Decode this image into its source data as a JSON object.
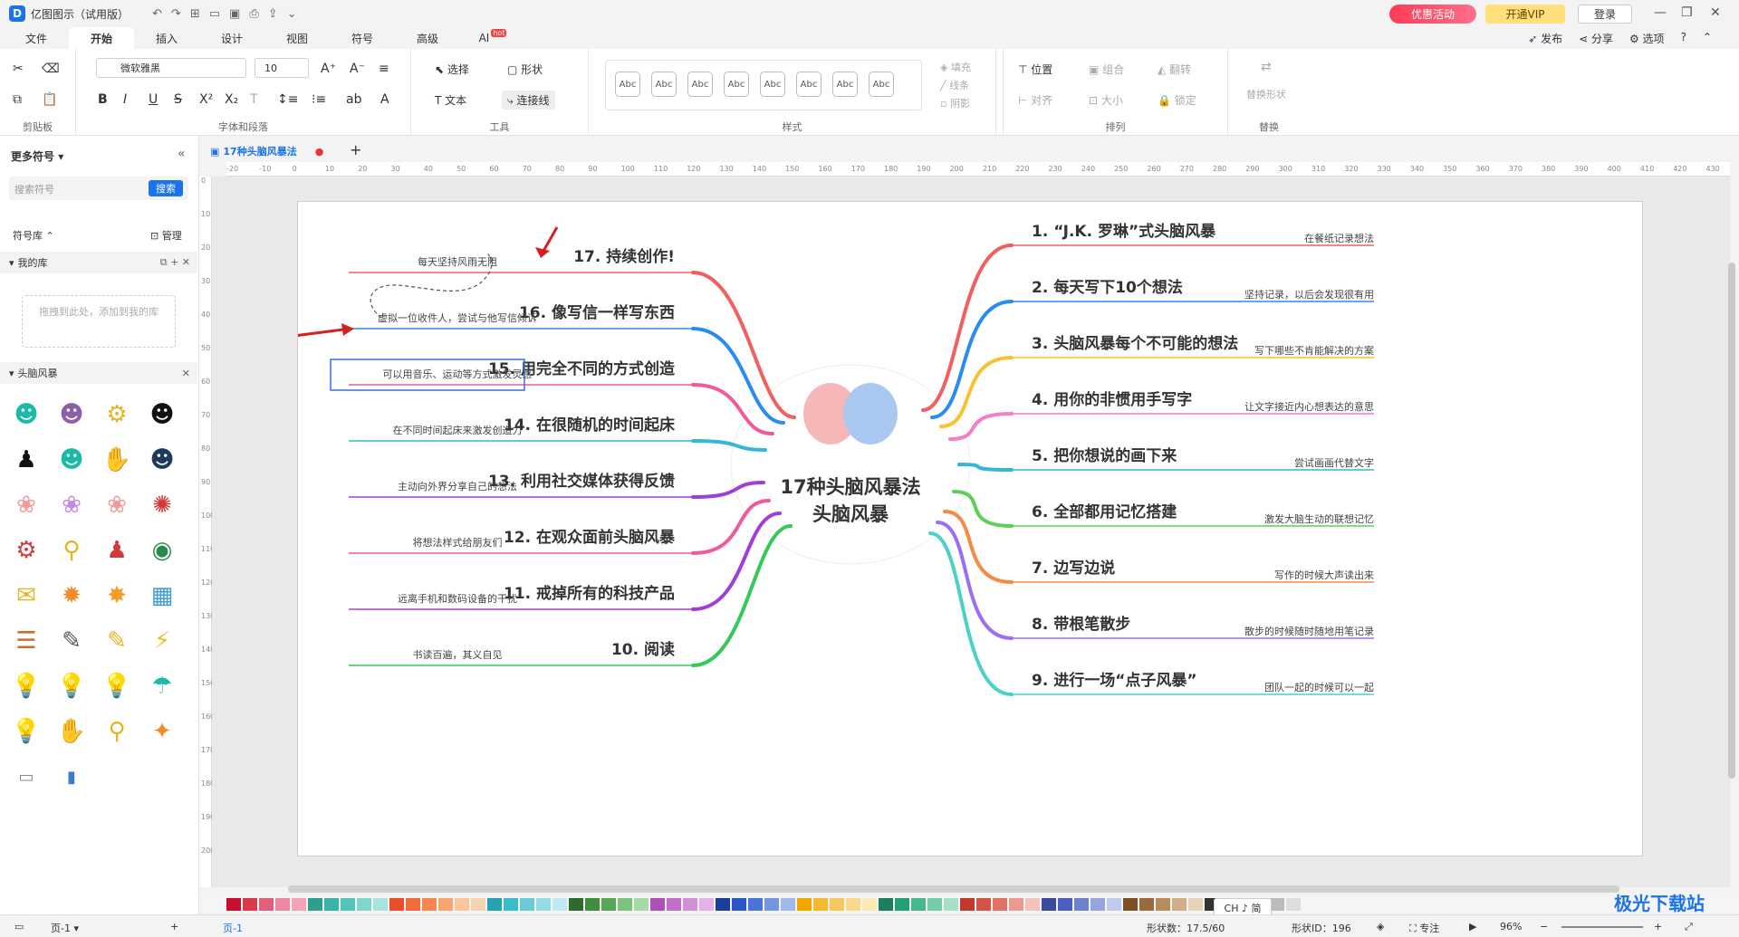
{
  "app": {
    "title": "亿图图示（试用版）",
    "promo": "优惠活动",
    "vip": "开通VIP",
    "login": "登录"
  },
  "menu": {
    "tabs": [
      "文件",
      "开始",
      "插入",
      "设计",
      "视图",
      "符号",
      "高级",
      "AI"
    ],
    "hot": "hot",
    "publish": "发布",
    "share": "分享",
    "options": "选项"
  },
  "ribbon": {
    "font": "微软雅黑",
    "size": "10",
    "groups": [
      "剪贴板",
      "字体和段落",
      "工具",
      "样式",
      "排列",
      "替换"
    ],
    "select": "选择",
    "shape": "形状",
    "text": "文本",
    "connector": "连接线",
    "fill": "填充",
    "line": "线条",
    "shadow": "阴影",
    "position": "位置",
    "group": "组合",
    "flip": "翻转",
    "align": "对齐",
    "size_lbl": "大小",
    "lock": "锁定",
    "replace": "替换形状",
    "style_sample": "Abc"
  },
  "sidebar": {
    "title": "更多符号",
    "search_placeholder": "搜索符号",
    "search_btn": "搜索",
    "library": "符号库",
    "manage": "管理",
    "my_lib": "我的库",
    "drop_hint": "拖拽到此处，添加到我的库",
    "category": "头脑风暴"
  },
  "doc": {
    "tab": "17种头脑风暴法"
  },
  "mindmap": {
    "center_line1": "17种头脑风暴法",
    "center_line2": "头脑风暴",
    "right": [
      {
        "t": "1. “J.K. 罗琳”式头脑风暴",
        "n": "在餐纸记录想法",
        "color": "#f0605f"
      },
      {
        "t": "2. 每天写下10个想法",
        "n": "坚持记录，以后会发现很有用",
        "color": "#2b8cf0"
      },
      {
        "t": "3. 头脑风暴每个不可能的想法",
        "n": "写下哪些不肯能解决的方案",
        "color": "#f7c331"
      },
      {
        "t": "4. 用你的非惯用手写字",
        "n": "让文字接近内心想表达的意思",
        "color": "#f47fc5"
      },
      {
        "t": "5. 把你想说的画下来",
        "n": "尝试画画代替文字",
        "color": "#34b7d6"
      },
      {
        "t": "6. 全部都用记忆搭建",
        "n": "激发大脑生动的联想记忆",
        "color": "#5ccf56"
      },
      {
        "t": "7. 边写边说",
        "n": "写作的时候大声读出来",
        "color": "#f58a45"
      },
      {
        "t": "8. 带根笔散步",
        "n": "散步的时候随时随地用笔记录",
        "color": "#9b6ef2"
      },
      {
        "t": "9. 进行一场“点子风暴”",
        "n": "团队一起的时候可以一起",
        "color": "#4cd1c6"
      }
    ],
    "left": [
      {
        "t": "17. 持续创作!",
        "n": "每天坚持风雨无阻",
        "color": "#f0605f"
      },
      {
        "t": "16. 像写信一样写东西",
        "n": "虚拟一位收件人，尝试与他写信倾诉",
        "color": "#2b8cf0"
      },
      {
        "t": "15. 用完全不同的方式创造",
        "n": "可以用音乐、运动等方式激发灵感",
        "color": "#f05a9c"
      },
      {
        "t": "14. 在很随机的时间起床",
        "n": "在不同时间起床来激发创造力",
        "color": "#34b7d6"
      },
      {
        "t": "13. 利用社交媒体获得反馈",
        "n": "主动向外界分享自己的想法",
        "color": "#a23ed8"
      },
      {
        "t": "12. 在观众面前头脑风暴",
        "n": "将想法样式给朋友们",
        "color": "#f05a9c"
      },
      {
        "t": "11. 戒掉所有的科技产品",
        "n": "远离手机和数码设备的干扰",
        "color": "#a23ed8"
      },
      {
        "t": "10. 阅读",
        "n": "书读百遍，其义自见",
        "color": "#36c95a"
      }
    ]
  },
  "status": {
    "page": "页-1",
    "page_tab": "页-1",
    "shape_count": "形状数：17.5/60",
    "shape_id": "形状ID：196",
    "focus": "专注",
    "zoom": "96%",
    "ime": "CH ♪ 简",
    "watermark": "极光下载站"
  }
}
